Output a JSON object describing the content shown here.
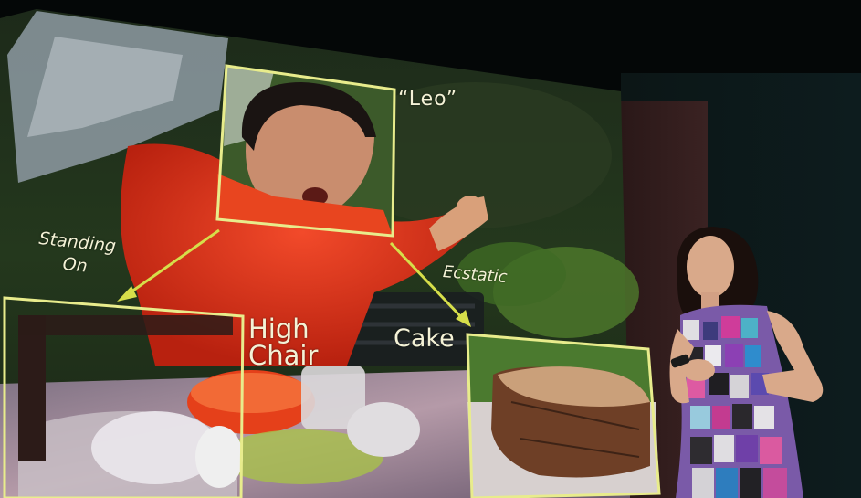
{
  "scene": {
    "description_colors": {
      "frame_color": "#e8ec8c",
      "arrow_color": "#d6de4a",
      "label_color": "#f4f2d6"
    }
  },
  "slide": {
    "labels": {
      "leo": "“Leo”",
      "standing_on_line1": "Standing",
      "standing_on_line2": "On",
      "ecstatic": "Ecstatic",
      "high_chair_line1": "High",
      "high_chair_line2": "Chair",
      "cake": "Cake"
    }
  }
}
